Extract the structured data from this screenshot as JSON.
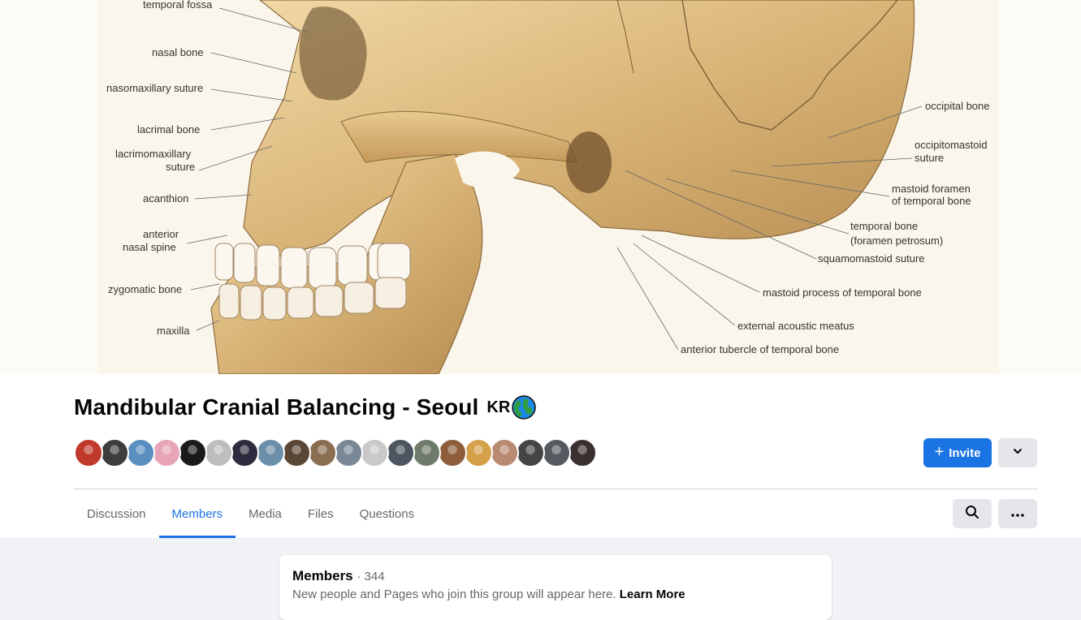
{
  "cover": {
    "labels_left": [
      "temporal fossa",
      "nasal bone",
      "nasomaxillary suture",
      "lacrimal bone",
      "lacrimomaxillary",
      "suture",
      "acanthion",
      "anterior",
      "nasal spine",
      "zygomatic bone",
      "maxilla"
    ],
    "labels_right": [
      "occipital bone",
      "occipitomastoid",
      "suture",
      "mastoid foramen",
      "of temporal bone",
      "temporal bone",
      "(foramen petrosum)",
      "squamomastoid suture",
      "mastoid process of temporal bone",
      "external acoustic meatus",
      "anterior tubercle of temporal bone"
    ]
  },
  "group": {
    "name": "Mandibular Cranial Balancing - Seoul",
    "country_code": "KR"
  },
  "member_avatars_count": 20,
  "actions": {
    "invite_label": "Invite"
  },
  "tabs": [
    {
      "label": "Discussion"
    },
    {
      "label": "Members"
    },
    {
      "label": "Media"
    },
    {
      "label": "Files"
    },
    {
      "label": "Questions"
    }
  ],
  "active_tab": "Members",
  "members_card": {
    "title": "Members",
    "count_text": "· 344",
    "description": "New people and Pages who join this group will appear here.",
    "learn_more": "Learn More"
  },
  "colors": {
    "accent": "#1b74e4",
    "secondary_button": "#e4e6eb",
    "page_bg": "#f0f2f5"
  }
}
